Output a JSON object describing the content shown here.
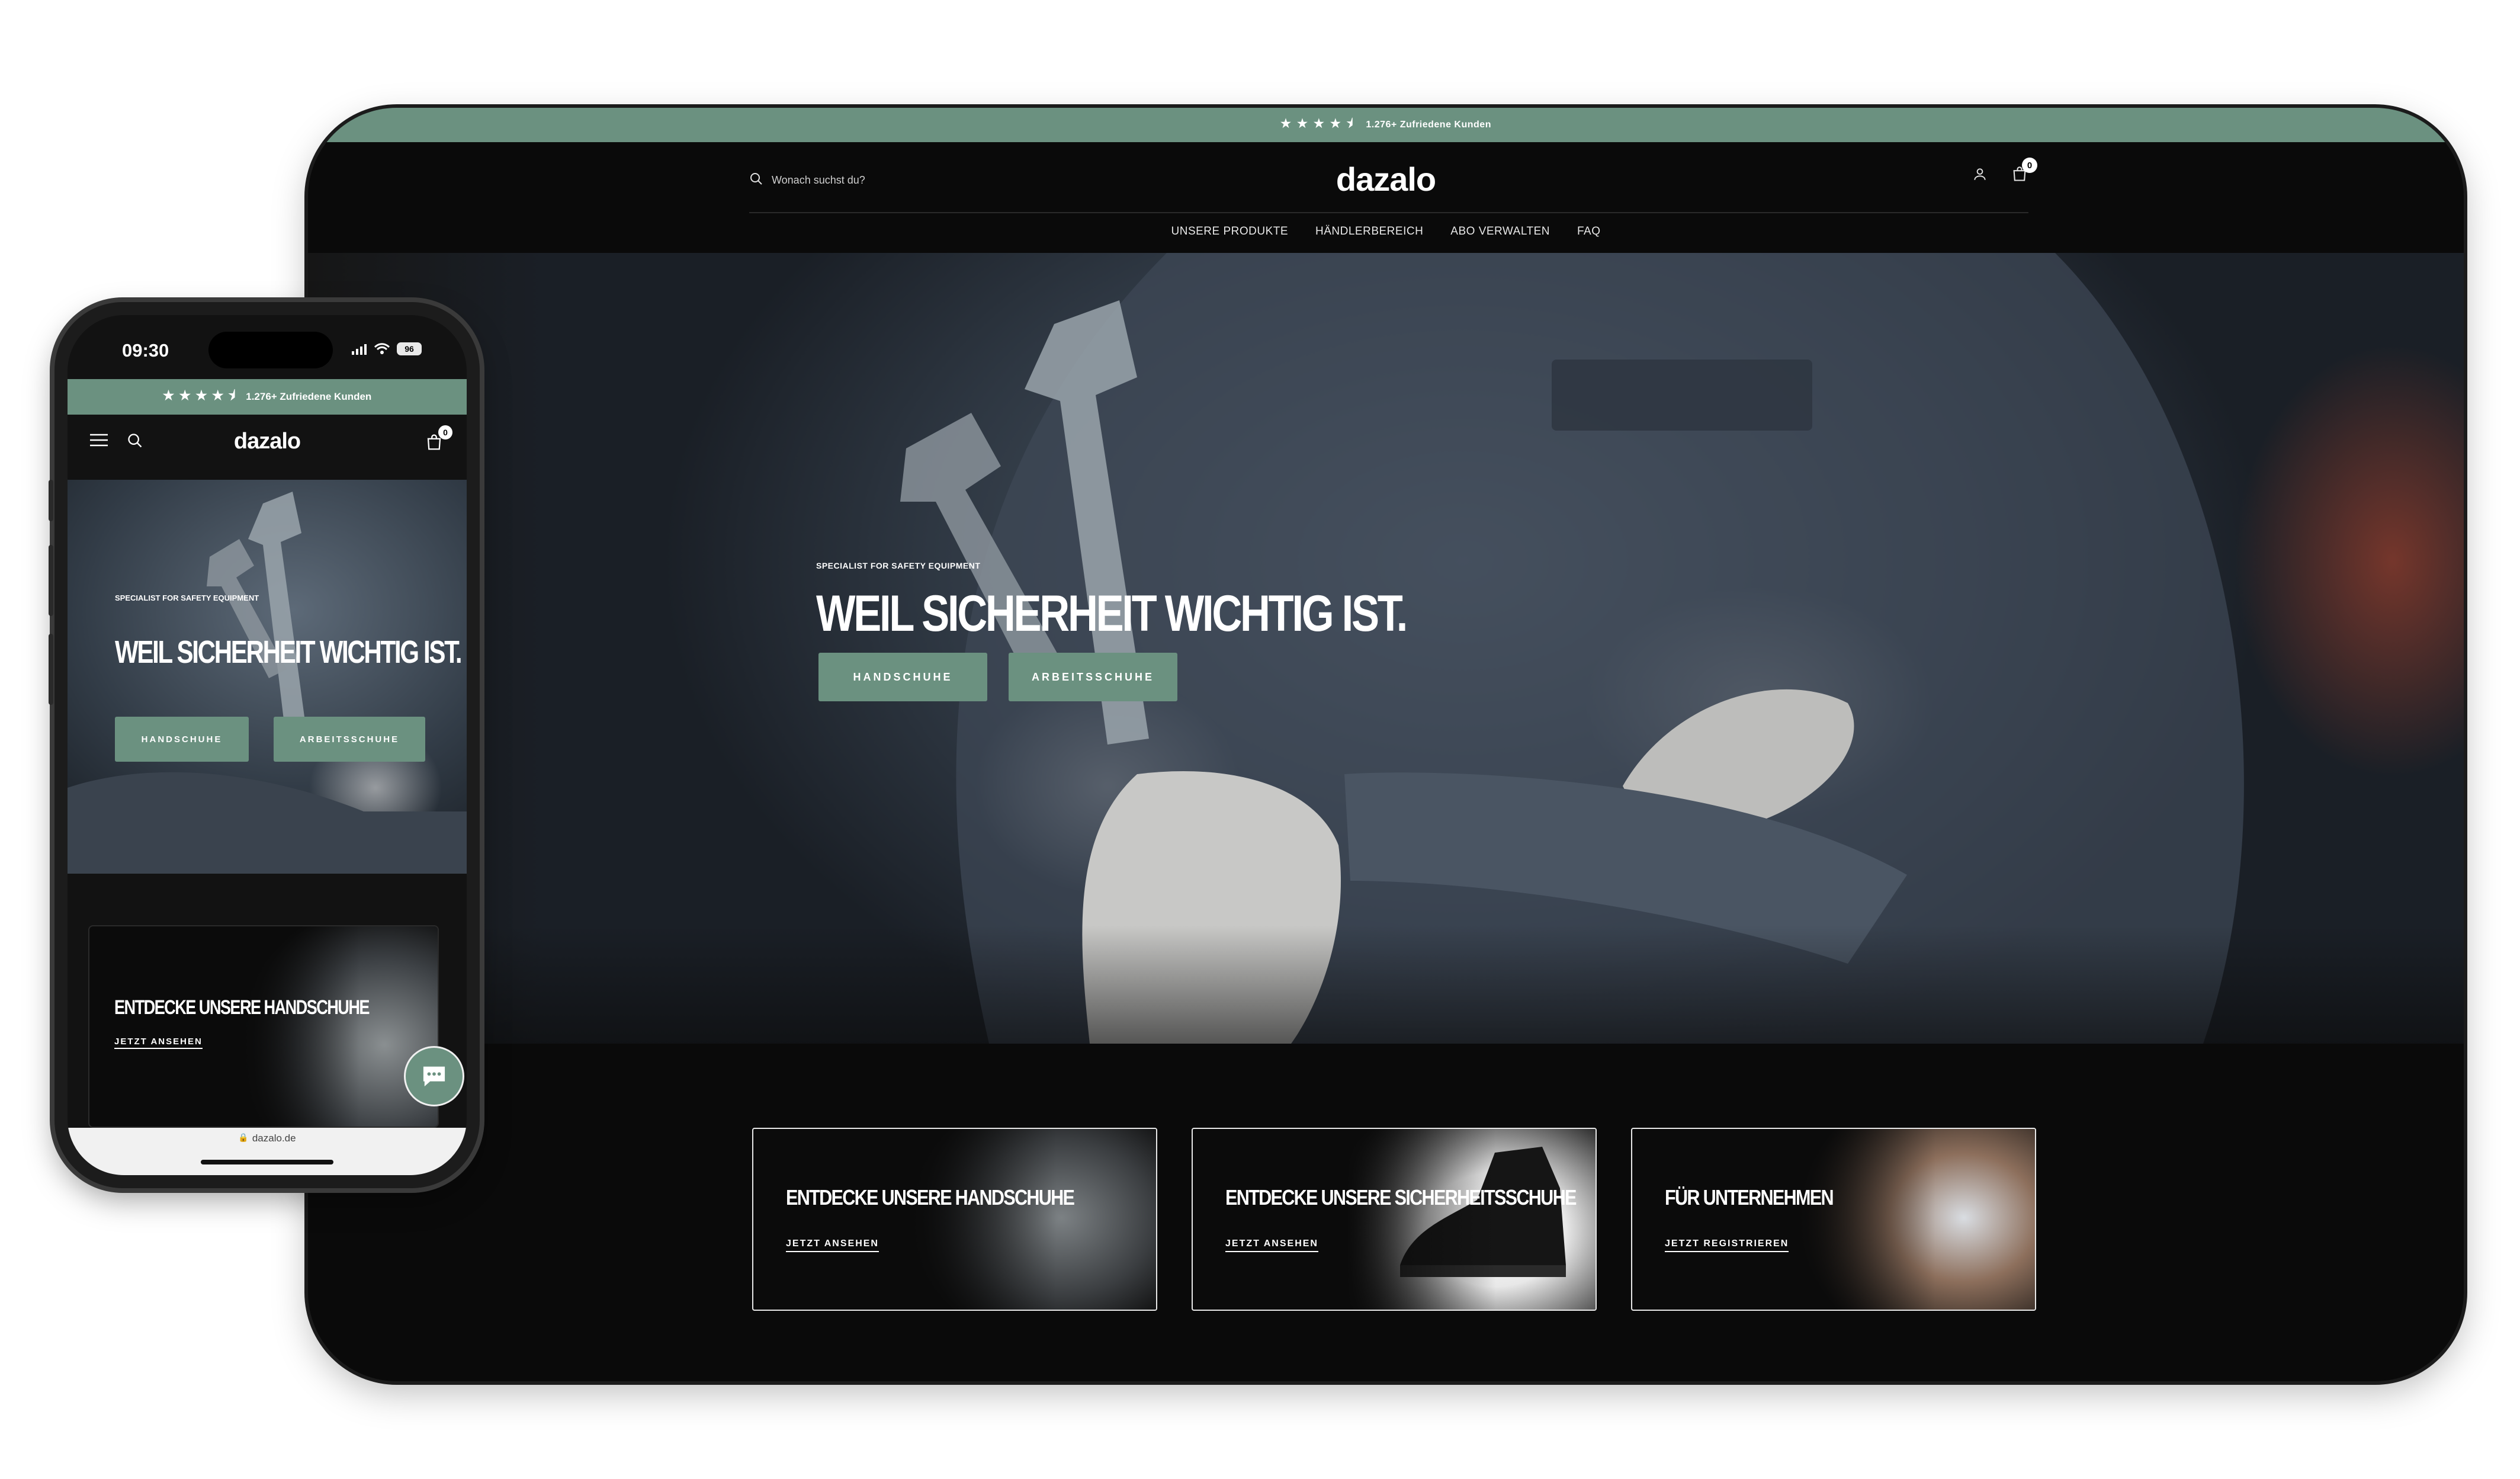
{
  "brand": {
    "logo": "dazalo",
    "accent_color": "#6b9180",
    "background_color": "#0a0a0a"
  },
  "desktop": {
    "promo": {
      "stars": "★★★★⯨",
      "text": "1.276+ Zufriedene Kunden"
    },
    "search_placeholder": "Wonach suchst du?",
    "cart_count": "0",
    "nav": [
      "UNSERE PRODUKTE",
      "HÄNDLERBEREICH",
      "ABO VERWALTEN",
      "FAQ"
    ],
    "hero": {
      "eyebrow": "SPECIALIST FOR SAFETY EQUIPMENT",
      "title": "WEIL SICHERHEIT WICHTIG IST.",
      "buttons": [
        "HANDSCHUHE",
        "ARBEITSSCHUHE"
      ]
    },
    "cards": [
      {
        "title": "ENTDECKE UNSERE HANDSCHUHE",
        "link": "JETZT ANSEHEN"
      },
      {
        "title": "ENTDECKE UNSERE SICHERHEITSSCHUHE",
        "link": "JETZT ANSEHEN"
      },
      {
        "title": "FÜR UNTERNEHMEN",
        "link": "JETZT REGISTRIEREN"
      }
    ]
  },
  "mobile": {
    "status": {
      "time": "09:30",
      "battery": "96"
    },
    "promo": {
      "stars": "★★★★⯨",
      "text": "1.276+ Zufriedene Kunden"
    },
    "cart_count": "0",
    "hero": {
      "eyebrow": "SPECIALIST FOR SAFETY EQUIPMENT",
      "title": "WEIL SICHERHEIT WICHTIG IST.",
      "buttons": [
        "HANDSCHUHE",
        "ARBEITSSCHUHE"
      ]
    },
    "card": {
      "title": "ENTDECKE UNSERE HANDSCHUHE",
      "link": "JETZT ANSEHEN"
    },
    "url": "dazalo.de"
  }
}
